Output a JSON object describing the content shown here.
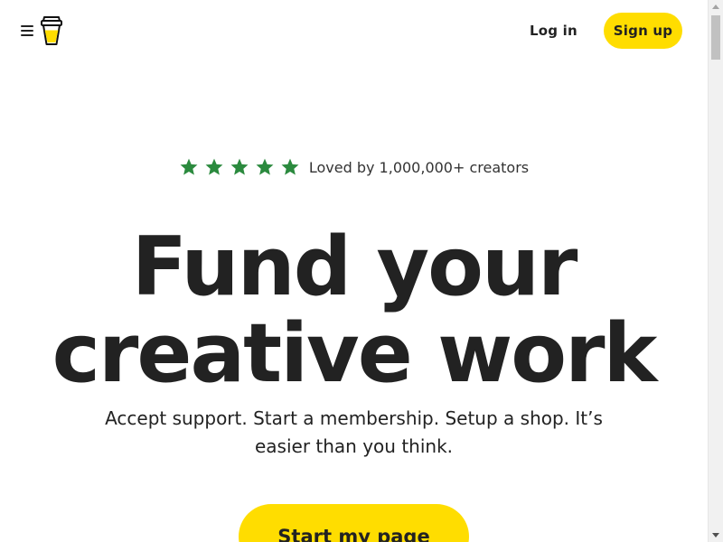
{
  "header": {
    "menu_icon": "hamburger-menu-icon",
    "logo_icon": "coffee-cup-logo-icon",
    "login_label": "Log in",
    "signup_label": "Sign up"
  },
  "hero": {
    "rating": {
      "stars": 5,
      "star_icon": "star-icon",
      "star_color": "#2B8A3E",
      "text": "Loved by 1,000,000+ creators"
    },
    "headline_line1": "Fund your",
    "headline_line2": "creative work",
    "subtext": "Accept support. Start a membership. Setup a shop. It’s easier than you think.",
    "cta_label": "Start my page"
  },
  "colors": {
    "accent": "#FFDD00",
    "text": "#222222",
    "background": "#FFFFFF"
  }
}
